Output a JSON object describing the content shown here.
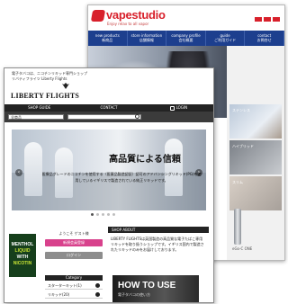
{
  "vapestudio": {
    "logo": "vapestudio",
    "tagline": "Enjoy relax to all vapor",
    "nav": [
      {
        "label": "new products\n新商品"
      },
      {
        "label": "store information\n店舗情報"
      },
      {
        "label": "company profile\n会社概要"
      },
      {
        "label": "guide\nご利用ガイド"
      },
      {
        "label": "contact\nお問合せ"
      }
    ],
    "panels": [
      "ステンレス",
      "ハイブリッド",
      "スリム"
    ],
    "product_label": "eGo-C ONE"
  },
  "liberty": {
    "tagline": "電子タバコは、ニコチンリキッド専門ショップ\nリバティフライツ Liberty Flights",
    "logo": "LIBERTY FLIGHTS",
    "nav": {
      "shop_guide": "SHOP GUIDE",
      "contact": "CONTACT",
      "login": "LOGIN"
    },
    "search": {
      "category_value": "全商品",
      "placeholder": ""
    },
    "slider": {
      "headline": "高品質による信頼",
      "caption": "医療品グレードのニコチンを使用する（医薬品製造認証）認可のアドバンシングリキッド(PG)を使用しているイギリスで製造されている純正リキッドです。",
      "prev": "‹",
      "next": "›"
    },
    "banner": {
      "line1": "MENTHOL",
      "line2": "LIQUID",
      "line3": "WITH",
      "line4": "NICOTIN"
    },
    "lang": {
      "title": "ようこそ ゲスト様",
      "primary": "新規会員登録",
      "secondary": "ログイン"
    },
    "category": {
      "title": "Category",
      "items": [
        "スターターキット(1)",
        "リキッド(20)"
      ]
    },
    "about": {
      "head": "SHOP ABOUT",
      "text": "LIBERTY FLIGHTSは英国製造の高品質な電子たばこ専用リキッドを取り扱うショップです。イギリス国内で製造されたリキッドのみをお届けしております。"
    },
    "howto": {
      "title": "HOW TO USE",
      "subtitle": "電子タバコの使い方"
    }
  }
}
